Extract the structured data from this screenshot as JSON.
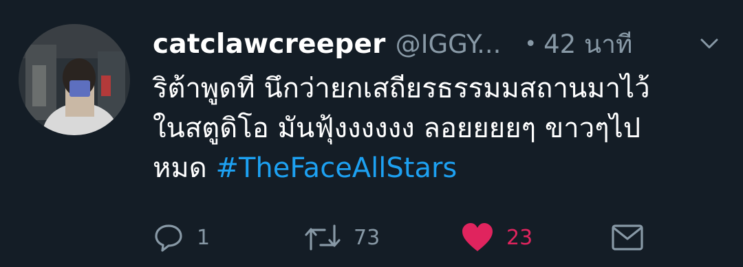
{
  "tweet": {
    "display_name": "catclawcreeper",
    "handle": "@IGGY...",
    "dot": "•",
    "time": "42 นาที",
    "text_lines": [
      "ริต้าพูดที นึกว่ายกเสถียรธรรมมสถานมาไว้",
      "ในสตูดิโอ มันฟุ้งงงงงง ลอยยยยๆ ขาวๆไป",
      "หมด "
    ],
    "hashtag": "#TheFaceAllStars"
  },
  "actions": {
    "reply_count": "1",
    "retweet_count": "73",
    "like_count": "23"
  },
  "colors": {
    "background": "#141d26",
    "secondary_text": "#8899a6",
    "hashtag": "#1da1f2",
    "like": "#e0245e"
  },
  "icons": [
    "avatar-photo",
    "chevron-down-icon",
    "reply-icon",
    "retweet-icon",
    "heart-icon",
    "message-icon"
  ]
}
